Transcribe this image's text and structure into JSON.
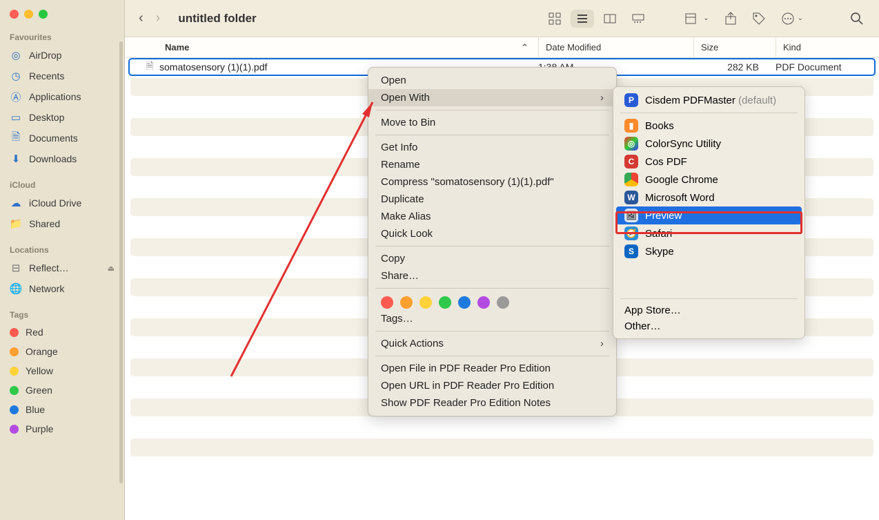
{
  "window_title": "untitled folder",
  "traffic": {
    "close": "close",
    "min": "minimize",
    "max": "maximize"
  },
  "sidebar": {
    "favourites_label": "Favourites",
    "icloud_label": "iCloud",
    "locations_label": "Locations",
    "tags_label": "Tags",
    "favourites": [
      {
        "icon": "airdrop",
        "label": "AirDrop"
      },
      {
        "icon": "clock",
        "label": "Recents"
      },
      {
        "icon": "apps",
        "label": "Applications"
      },
      {
        "icon": "desktop",
        "label": "Desktop"
      },
      {
        "icon": "doc",
        "label": "Documents"
      },
      {
        "icon": "download",
        "label": "Downloads"
      }
    ],
    "icloud": [
      {
        "icon": "cloud",
        "label": "iCloud Drive"
      },
      {
        "icon": "shared",
        "label": "Shared"
      }
    ],
    "locations": [
      {
        "icon": "disk",
        "label": "Reflect…",
        "eject": true
      },
      {
        "icon": "globe",
        "label": "Network"
      }
    ],
    "tags": [
      {
        "color": "#ff5b50",
        "label": "Red"
      },
      {
        "color": "#ff9f2f",
        "label": "Orange"
      },
      {
        "color": "#ffd23a",
        "label": "Yellow"
      },
      {
        "color": "#2fc94a",
        "label": "Green"
      },
      {
        "color": "#1f7ae0",
        "label": "Blue"
      },
      {
        "color": "#b44be0",
        "label": "Purple"
      }
    ]
  },
  "columns": {
    "name": "Name",
    "date": "Date Modified",
    "size": "Size",
    "kind": "Kind"
  },
  "file": {
    "name": "somatosensory (1)(1).pdf",
    "date": "1:38 AM",
    "size": "282 KB",
    "kind": "PDF Document"
  },
  "context_menu": {
    "open": "Open",
    "open_with": "Open With",
    "move_to_bin": "Move to Bin",
    "get_info": "Get Info",
    "rename": "Rename",
    "compress": "Compress \"somatosensory (1)(1).pdf\"",
    "duplicate": "Duplicate",
    "make_alias": "Make Alias",
    "quick_look": "Quick Look",
    "copy": "Copy",
    "share": "Share…",
    "tags": "Tags…",
    "quick_actions": "Quick Actions",
    "open_pdf_pro": "Open File in PDF Reader Pro Edition",
    "open_url_pdf_pro": "Open URL in PDF Reader Pro Edition",
    "show_notes_pdf_pro": "Show PDF Reader Pro Edition Notes",
    "tag_colors": [
      "#ff5b50",
      "#ff9f2f",
      "#ffd23a",
      "#2fc94a",
      "#1f7ae0",
      "#b44be0",
      "#9a9a9a"
    ]
  },
  "open_with_menu": {
    "default_app": "Cisdem PDFMaster",
    "default_suffix": "(default)",
    "apps": [
      {
        "label": "Books",
        "bg": "#ff8a2b"
      },
      {
        "label": "ColorSync Utility",
        "bg": "linear-gradient(135deg,#f33,#3c3,#33f)"
      },
      {
        "label": "Cos PDF",
        "bg": "#d43a32"
      },
      {
        "label": "Google Chrome",
        "bg": "#fff"
      },
      {
        "label": "Microsoft Word",
        "bg": "#2b579a"
      },
      {
        "label": "Preview",
        "bg": "#3a6ea5",
        "highlight": true
      },
      {
        "label": "Safari",
        "bg": "#2a8ed9"
      },
      {
        "label": "Skype",
        "bg": "#0b66c3"
      }
    ],
    "app_store": "App Store…",
    "other": "Other…"
  }
}
